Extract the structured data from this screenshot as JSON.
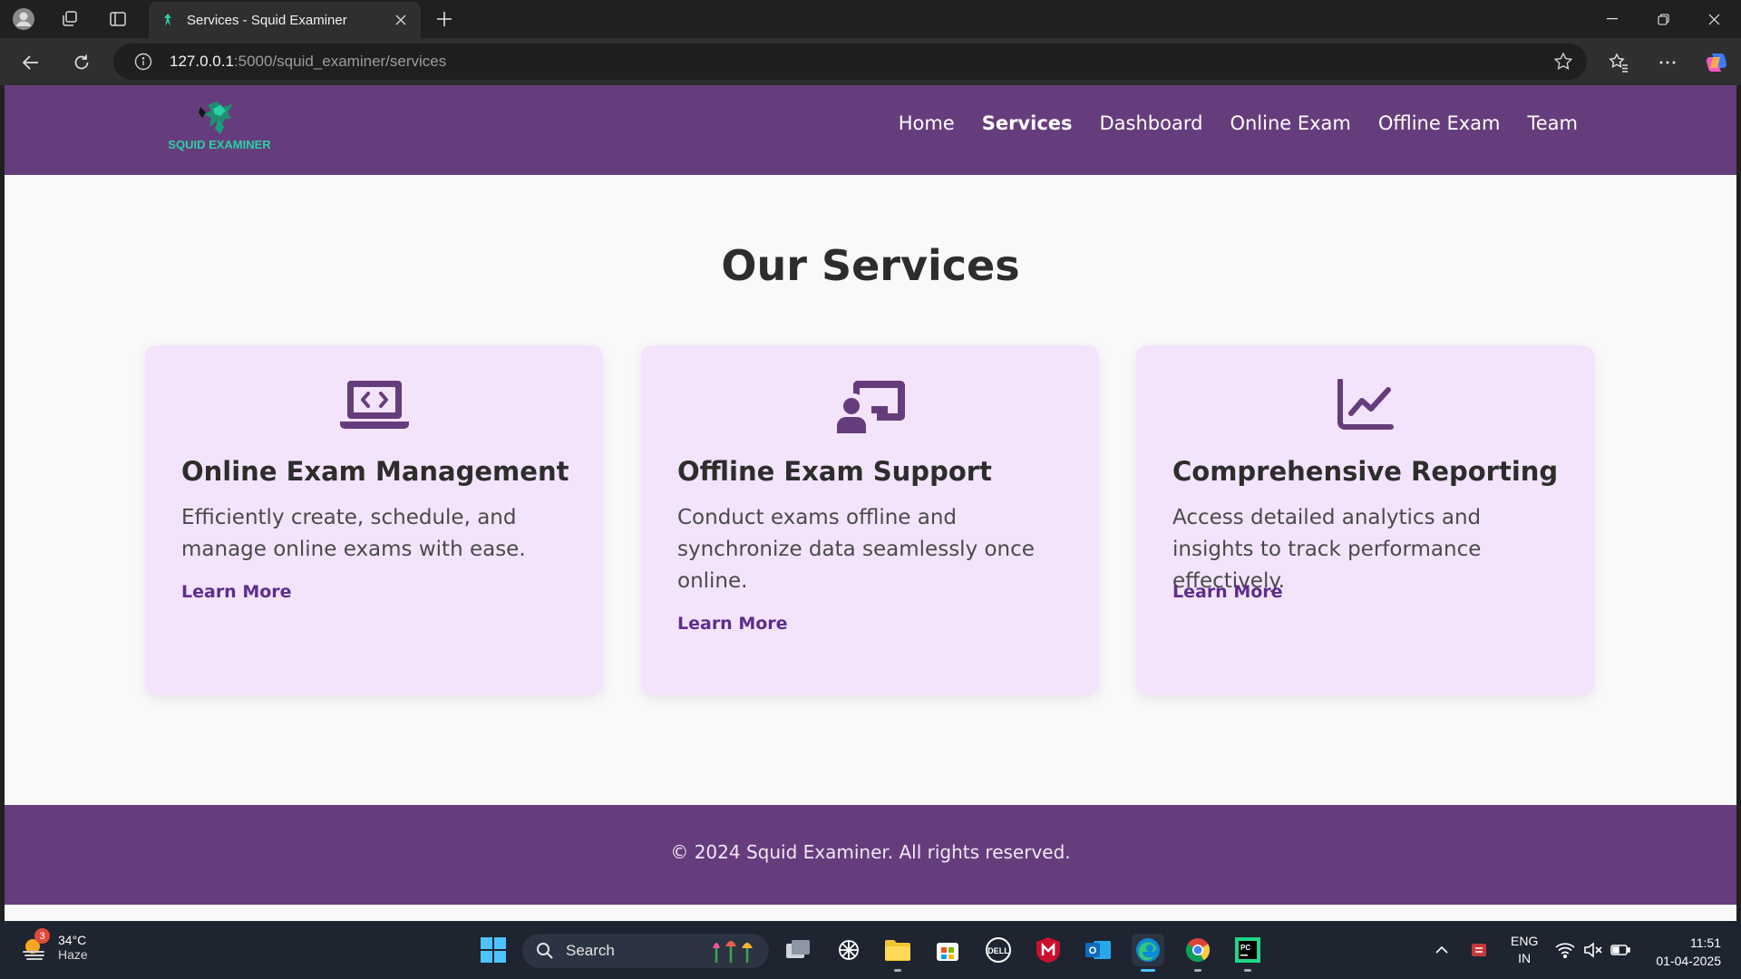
{
  "browser": {
    "tab_title": "Services - Squid Examiner",
    "url_host": "127.0.0.1",
    "url_path": ":5000/squid_examiner/services"
  },
  "site": {
    "logo_text": "SQUID EXAMINER",
    "nav": [
      {
        "label": "Home",
        "active": false
      },
      {
        "label": "Services",
        "active": true
      },
      {
        "label": "Dashboard",
        "active": false
      },
      {
        "label": "Online Exam",
        "active": false
      },
      {
        "label": "Offline Exam",
        "active": false
      },
      {
        "label": "Team",
        "active": false
      }
    ],
    "page_title": "Our Services",
    "cards": [
      {
        "icon": "laptop-code-icon",
        "title": "Online Exam Management",
        "description": "Efficiently create, schedule, and manage online exams with ease.",
        "link": "Learn More"
      },
      {
        "icon": "chalkboard-teacher-icon",
        "title": "Offline Exam Support",
        "description": "Conduct exams offline and synchronize data seamlessly once online.",
        "link": "Learn More"
      },
      {
        "icon": "chart-line-icon",
        "title": "Comprehensive Reporting",
        "description": "Access detailed analytics and insights to track performance effectively.",
        "link": "Learn More"
      }
    ],
    "footer": "© 2024 Squid Examiner. All rights reserved.",
    "colors": {
      "brand": "#663d7c",
      "card_bg": "#f3e4fb",
      "link": "#5f2d8f"
    }
  },
  "taskbar": {
    "weather_temp": "34°C",
    "weather_desc": "Haze",
    "weather_badge": "3",
    "search_label": "Search",
    "lang_top": "ENG",
    "lang_bottom": "IN",
    "time": "11:51",
    "date": "01-04-2025"
  }
}
